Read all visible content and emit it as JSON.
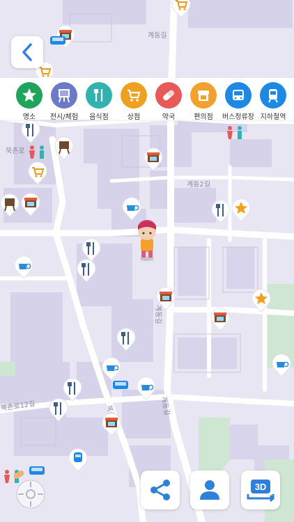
{
  "app": {
    "screen": "map"
  },
  "toolbar": {
    "back_icon": "chevron-left-icon"
  },
  "categories": [
    {
      "label": "명소",
      "icon": "star-icon",
      "color": "#20a35a"
    },
    {
      "label": "전시/체험",
      "icon": "easel-icon",
      "color": "#6c79c9"
    },
    {
      "label": "음식점",
      "icon": "fork-knife-icon",
      "color": "#2fb2b0"
    },
    {
      "label": "상점",
      "icon": "cart-icon",
      "color": "#f0a020"
    },
    {
      "label": "약국",
      "icon": "pill-icon",
      "color": "#e85a5a"
    },
    {
      "label": "편의점",
      "icon": "store-icon",
      "color": "#f2a12f"
    },
    {
      "label": "버스정류장",
      "icon": "bus-icon",
      "color": "#1e88e5"
    },
    {
      "label": "지하철역",
      "icon": "subway-icon",
      "color": "#1e88e5"
    }
  ],
  "map": {
    "streets": [
      "계동길",
      "계동2길",
      "계동길",
      "북촌로",
      "북촌로12길",
      "북촌로"
    ],
    "accent_color": "#2f80d8"
  },
  "bottom_buttons": {
    "share_icon": "share-icon",
    "profile_icon": "person-icon",
    "view3d_label": "3D"
  }
}
